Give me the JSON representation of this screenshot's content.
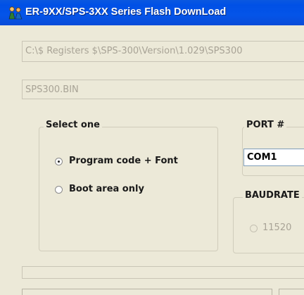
{
  "window": {
    "title": "ER-9XX/SPS-3XX Series Flash DownLoad",
    "icon": "flash-download-app-icon",
    "title_bar_color": "#0454e8"
  },
  "fields": {
    "path": "C:\\$ Registers $\\SPS-300\\Version\\1.029\\SPS300",
    "file": "SPS300.BIN"
  },
  "select_group": {
    "label": "Select one",
    "options": [
      {
        "label": "Program code + Font",
        "selected": true
      },
      {
        "label": "Boot area only",
        "selected": false
      }
    ]
  },
  "port_group": {
    "label": "PORT #",
    "selected": "COM1"
  },
  "baud_group": {
    "label": "BAUDRATE",
    "option": "11520"
  }
}
